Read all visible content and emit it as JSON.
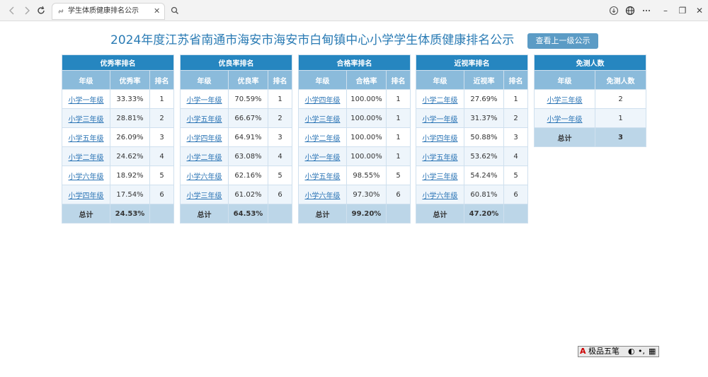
{
  "browser": {
    "tab_title": "学生体质健康排名公示",
    "tab_close": "✕",
    "icons": [
      "back-icon",
      "forward-icon",
      "reload-icon",
      "link-icon",
      "search-icon",
      "download-icon",
      "globe-icon",
      "more-icon"
    ]
  },
  "window": {
    "min": "–",
    "restore": "❐",
    "close": "✕"
  },
  "page": {
    "title": "2024年度江苏省南通市海安市海安市白甸镇中心小学学生体质健康排名公示",
    "up_button": "查看上一级公示"
  },
  "tables": [
    {
      "caption": "优秀率排名",
      "headers": [
        "年级",
        "优秀率",
        "排名"
      ],
      "rows": [
        [
          "小学一年级",
          "33.33%",
          "1"
        ],
        [
          "小学三年级",
          "28.81%",
          "2"
        ],
        [
          "小学五年级",
          "26.09%",
          "3"
        ],
        [
          "小学二年级",
          "24.62%",
          "4"
        ],
        [
          "小学六年级",
          "18.92%",
          "5"
        ],
        [
          "小学四年级",
          "17.54%",
          "6"
        ]
      ],
      "total": [
        "总计",
        "24.53%",
        ""
      ]
    },
    {
      "caption": "优良率排名",
      "headers": [
        "年级",
        "优良率",
        "排名"
      ],
      "rows": [
        [
          "小学一年级",
          "70.59%",
          "1"
        ],
        [
          "小学五年级",
          "66.67%",
          "2"
        ],
        [
          "小学四年级",
          "64.91%",
          "3"
        ],
        [
          "小学二年级",
          "63.08%",
          "4"
        ],
        [
          "小学六年级",
          "62.16%",
          "5"
        ],
        [
          "小学三年级",
          "61.02%",
          "6"
        ]
      ],
      "total": [
        "总计",
        "64.53%",
        ""
      ]
    },
    {
      "caption": "合格率排名",
      "headers": [
        "年级",
        "合格率",
        "排名"
      ],
      "rows": [
        [
          "小学四年级",
          "100.00%",
          "1"
        ],
        [
          "小学三年级",
          "100.00%",
          "1"
        ],
        [
          "小学二年级",
          "100.00%",
          "1"
        ],
        [
          "小学一年级",
          "100.00%",
          "1"
        ],
        [
          "小学五年级",
          "98.55%",
          "5"
        ],
        [
          "小学六年级",
          "97.30%",
          "6"
        ]
      ],
      "total": [
        "总计",
        "99.20%",
        ""
      ]
    },
    {
      "caption": "近视率排名",
      "headers": [
        "年级",
        "近视率",
        "排名"
      ],
      "rows": [
        [
          "小学二年级",
          "27.69%",
          "1"
        ],
        [
          "小学一年级",
          "31.37%",
          "2"
        ],
        [
          "小学四年级",
          "50.88%",
          "3"
        ],
        [
          "小学五年级",
          "53.62%",
          "4"
        ],
        [
          "小学三年级",
          "54.24%",
          "5"
        ],
        [
          "小学六年级",
          "60.81%",
          "6"
        ]
      ],
      "total": [
        "总计",
        "47.20%",
        ""
      ]
    }
  ],
  "exempt_table": {
    "caption": "免测人数",
    "headers": [
      "年级",
      "免测人数"
    ],
    "rows": [
      [
        "小学三年级",
        "2"
      ],
      [
        "小学一年级",
        "1"
      ]
    ],
    "total": [
      "总计",
      "3"
    ]
  },
  "ime": {
    "label": "极品五笔",
    "a": "A",
    "moon": "◐",
    "dots": "•,",
    "kbd": "▦"
  }
}
